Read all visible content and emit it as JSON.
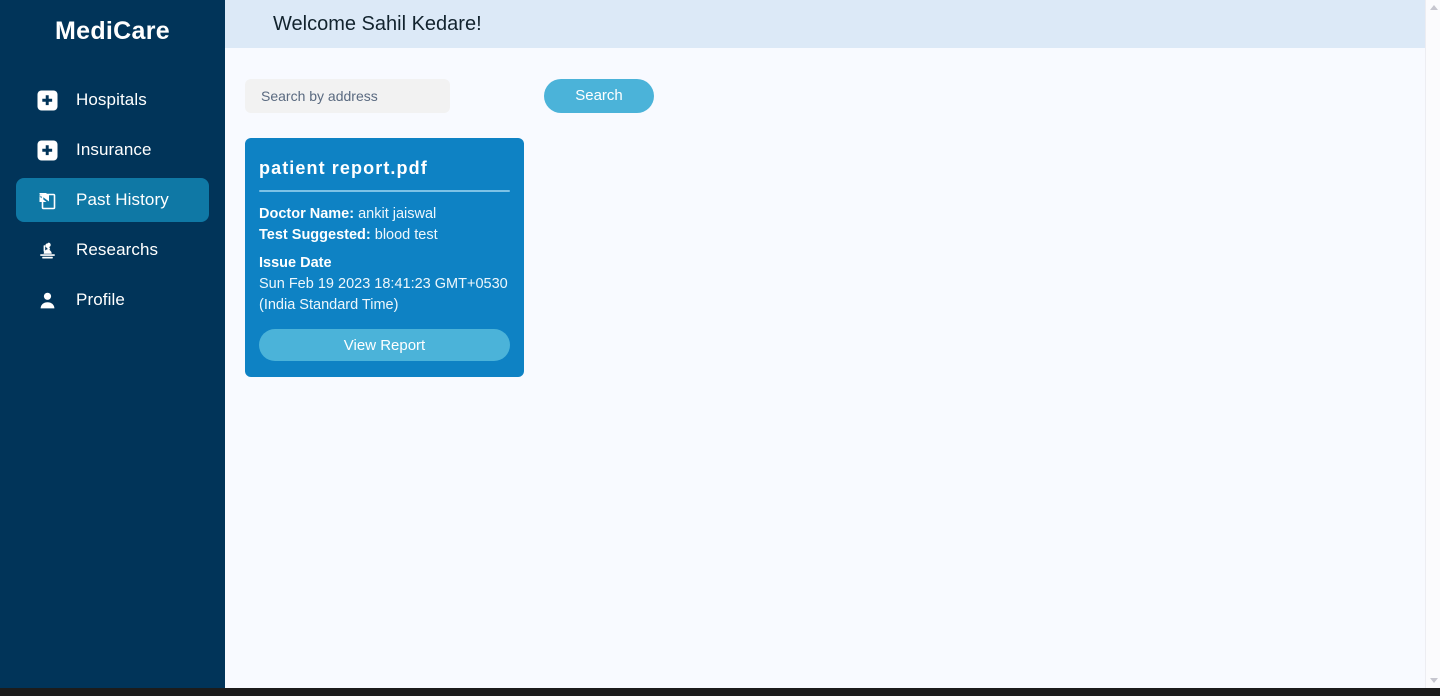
{
  "brand": {
    "name": "MediCare"
  },
  "sidebar": {
    "items": [
      {
        "label": "Hospitals",
        "icon": "hospital-plus-icon",
        "active": false
      },
      {
        "label": "Insurance",
        "icon": "insurance-plus-icon",
        "active": false
      },
      {
        "label": "Past History",
        "icon": "history-document-icon",
        "active": true
      },
      {
        "label": "Researchs",
        "icon": "microscope-icon",
        "active": false
      },
      {
        "label": "Profile",
        "icon": "user-icon",
        "active": false
      }
    ]
  },
  "header": {
    "welcome": "Welcome Sahil Kedare!"
  },
  "search": {
    "placeholder": "Search by address",
    "value": "",
    "button_label": "Search"
  },
  "report_card": {
    "file_name": "patient report.pdf",
    "doctor_label": "Doctor Name:",
    "doctor_name": "ankit jaiswal",
    "test_label": "Test Suggested:",
    "test_name": "blood test",
    "issue_date_label": "Issue Date",
    "issue_date": "Sun Feb 19 2023 18:41:23 GMT+0530 (India Standard Time)",
    "view_button_label": "View Report"
  },
  "colors": {
    "sidebar_bg": "#013459",
    "active_item": "#0f78a5",
    "header_bg": "#dce9f7",
    "card_bg": "#0e82c4",
    "accent_button": "#4bb3d9",
    "page_bg": "#f8faff"
  }
}
